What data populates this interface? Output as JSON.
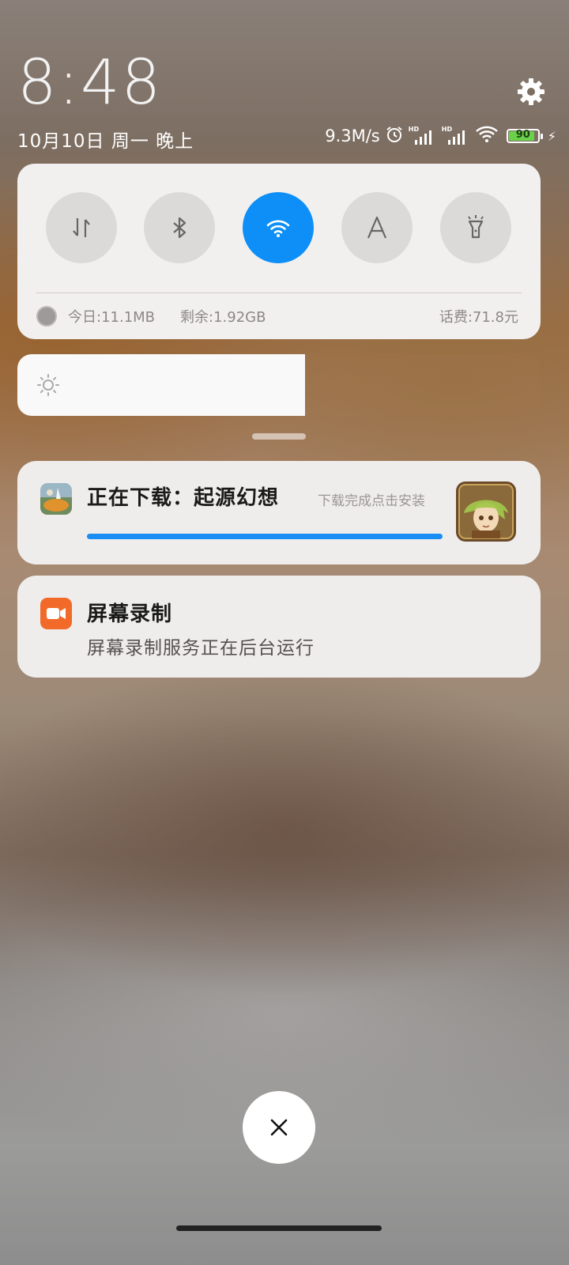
{
  "header": {
    "time": "8:48",
    "date": "10月10日 周一 晚上"
  },
  "status_bar": {
    "net_speed": "9.3M/s",
    "sim1_label": "HD",
    "sim2_label": "HD",
    "battery_level": "90",
    "battery_color": "#6bd14b",
    "icons": [
      "alarm-icon",
      "signal-hd-icon",
      "signal-hd-icon",
      "wifi-icon",
      "battery-icon",
      "charging-icon"
    ]
  },
  "quick_settings": {
    "toggles": [
      {
        "name": "mobile-data",
        "icon": "data-arrows-icon",
        "active": false
      },
      {
        "name": "bluetooth",
        "icon": "bluetooth-icon",
        "active": false
      },
      {
        "name": "wifi",
        "icon": "wifi-icon",
        "active": true
      },
      {
        "name": "auto-brightness",
        "icon": "letter-a-icon",
        "active": false
      },
      {
        "name": "flashlight",
        "icon": "flashlight-icon",
        "active": false
      }
    ],
    "accent_color": "#0d8ff7",
    "data_usage": {
      "today": "今日:11.1MB",
      "remaining": "剩余:1.92GB",
      "bill": "话费:71.8元"
    }
  },
  "brightness": {
    "level": 0.55,
    "icon": "sun-icon"
  },
  "notifications": [
    {
      "title": "正在下载：起源幻想",
      "hint": "下载完成点击安装",
      "progress": 1.0,
      "progress_color": "#1a8ef5"
    },
    {
      "title": "屏幕录制",
      "body": "屏幕录制服务正在后台运行",
      "icon_color": "#f26a2a"
    }
  ],
  "dismiss": {
    "icon": "close-icon"
  }
}
